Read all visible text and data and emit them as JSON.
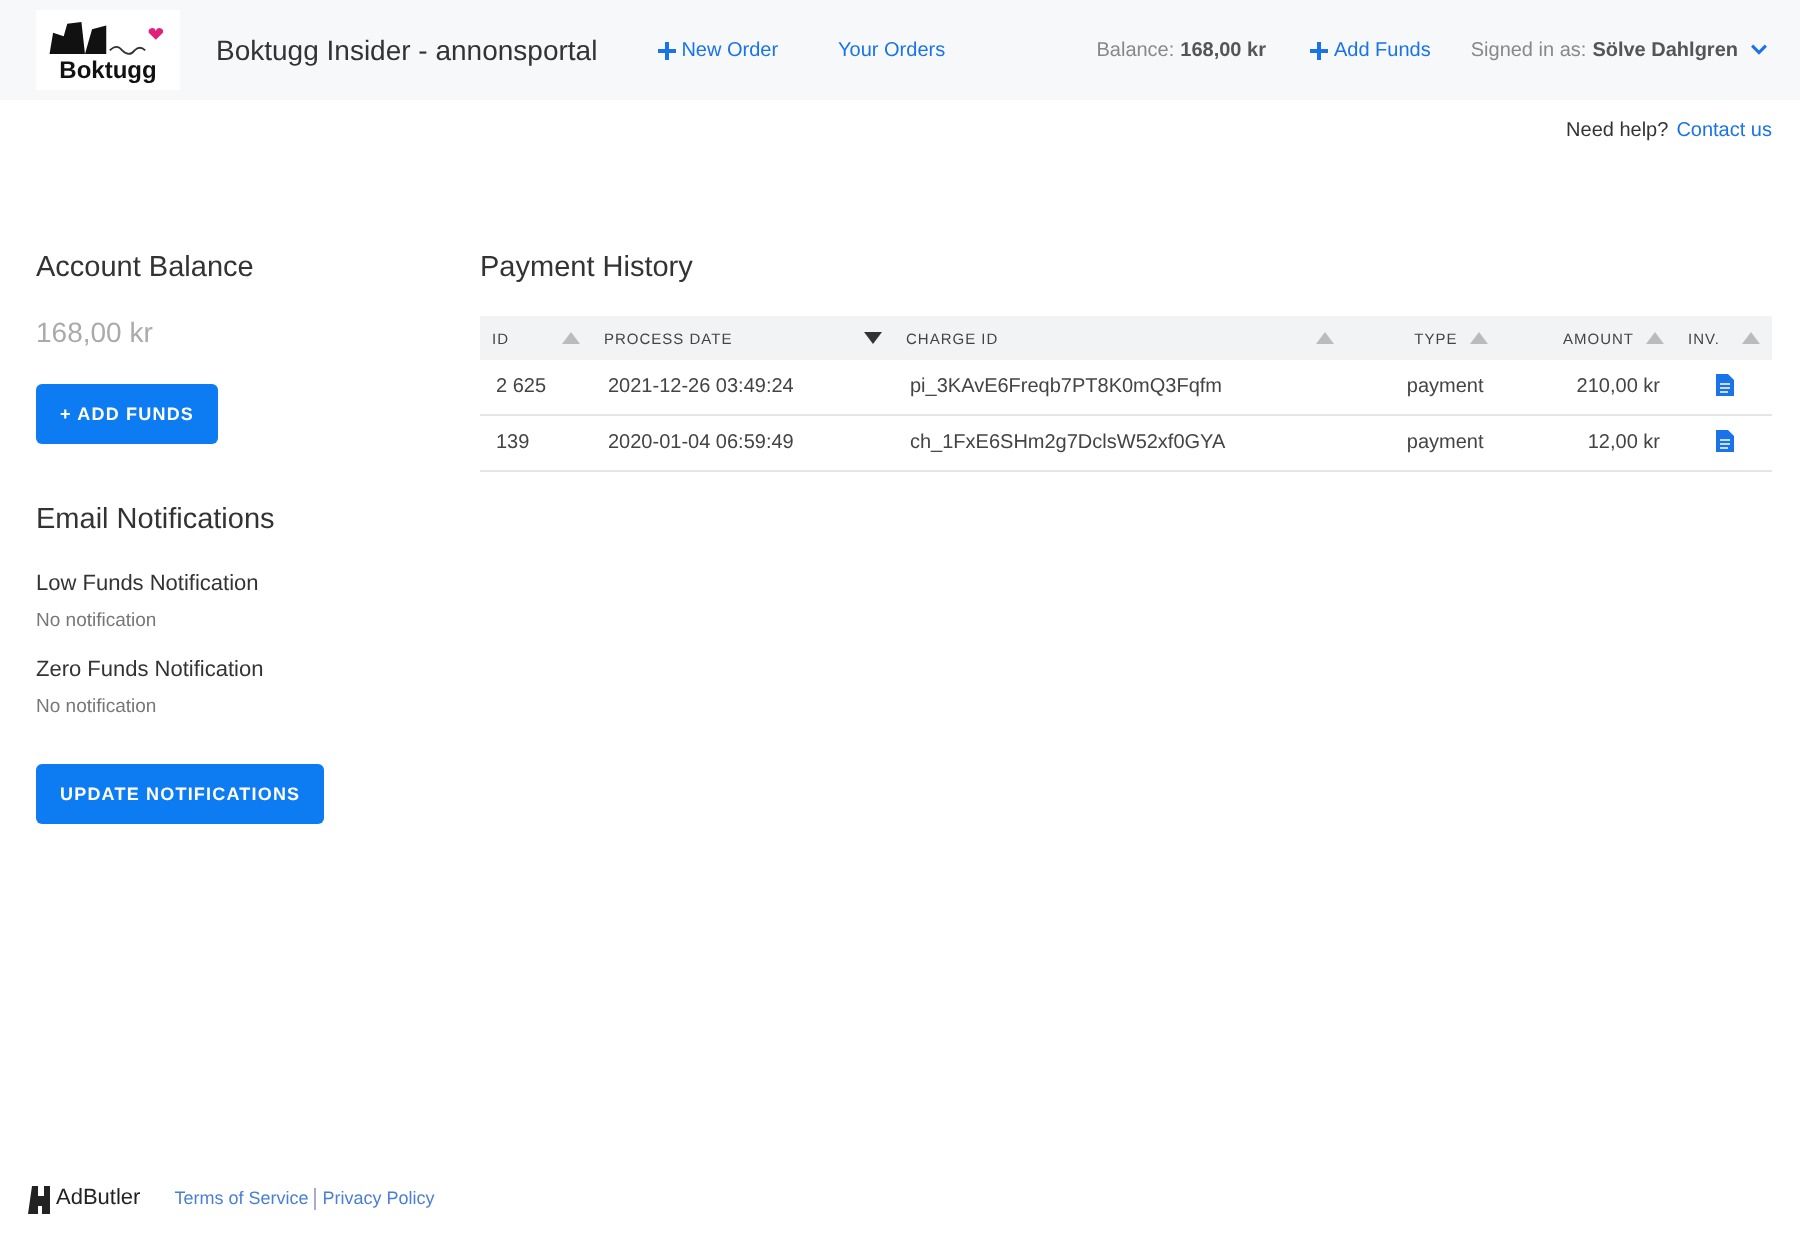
{
  "header": {
    "logo_text": "Boktugg",
    "title": "Boktugg Insider - annonsportal",
    "nav": [
      {
        "label": "New Order",
        "plus": true
      },
      {
        "label": "Your Orders",
        "plus": false
      }
    ],
    "balance_label": "Balance:",
    "balance_value": "168,00 kr",
    "add_funds": "Add Funds",
    "signed_label": "Signed in as:",
    "user": "Sölve Dahlgren"
  },
  "help": {
    "text": "Need help?",
    "link": "Contact us"
  },
  "account": {
    "title": "Account Balance",
    "balance": "168,00 kr",
    "button": "+ ADD FUNDS"
  },
  "notifications": {
    "title": "Email Notifications",
    "items": [
      {
        "label": "Low Funds Notification",
        "value": "No notification"
      },
      {
        "label": "Zero Funds Notification",
        "value": "No notification"
      }
    ],
    "button": "UPDATE NOTIFICATIONS"
  },
  "payment_history": {
    "title": "Payment History",
    "columns": [
      {
        "label": "ID",
        "sorted": false
      },
      {
        "label": "PROCESS DATE",
        "sorted": true
      },
      {
        "label": "CHARGE ID",
        "sorted": false
      },
      {
        "label": "TYPE",
        "sorted": false
      },
      {
        "label": "AMOUNT",
        "sorted": false
      },
      {
        "label": "INV.",
        "sorted": false
      }
    ],
    "rows": [
      [
        "2 625",
        "2021-12-26 03:49:24",
        "pi_3KAvE6Freqb7PT8K0mQ3Fqfm",
        "payment",
        "210,00 kr"
      ],
      [
        "139",
        "2020-01-04 06:59:49",
        "ch_1FxE6SHm2g7DclsW52xf0GYA",
        "payment",
        "12,00 kr"
      ]
    ]
  },
  "footer": {
    "brand": "AdButler",
    "links": [
      "Terms of Service",
      "Privacy Policy"
    ]
  }
}
